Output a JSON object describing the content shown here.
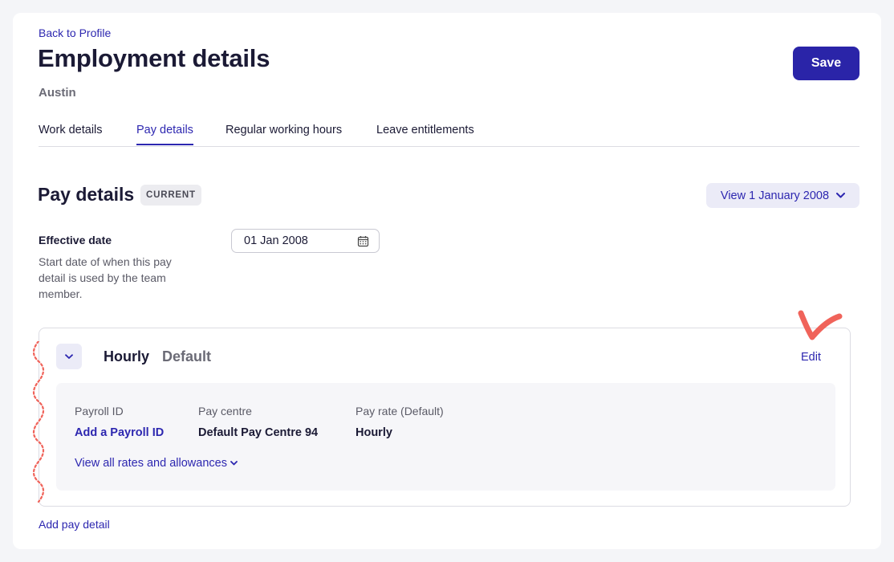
{
  "header": {
    "back_link": "Back to Profile",
    "title": "Employment details",
    "subtitle": "Austin",
    "save_label": "Save"
  },
  "tabs": [
    {
      "label": "Work details",
      "active": false
    },
    {
      "label": "Pay details",
      "active": true
    },
    {
      "label": "Regular working hours",
      "active": false
    },
    {
      "label": "Leave entitlements",
      "active": false
    }
  ],
  "section": {
    "title": "Pay details",
    "badge": "CURRENT",
    "view_dropdown": "View 1 January 2008"
  },
  "effective_date": {
    "label": "Effective date",
    "help": "Start date of when this pay detail is used by the team member.",
    "value": "01 Jan 2008"
  },
  "pay_card": {
    "title": "Hourly",
    "subtitle": "Default",
    "edit_label": "Edit",
    "columns": [
      {
        "label": "Payroll ID",
        "value": "Add a Payroll ID",
        "is_link": true
      },
      {
        "label": "Pay centre",
        "value": "Default Pay Centre 94",
        "is_link": false
      },
      {
        "label": "Pay rate (Default)",
        "value": "Hourly",
        "is_link": false
      }
    ],
    "rates_link": "View all rates and allowances"
  },
  "add_pay_detail": "Add pay detail",
  "colors": {
    "accent": "#2a24a8",
    "link": "#2d27b0",
    "annotation": "#f0635a"
  },
  "icons": {
    "calendar": "calendar-icon",
    "chevron_down": "chevron-down-icon"
  }
}
